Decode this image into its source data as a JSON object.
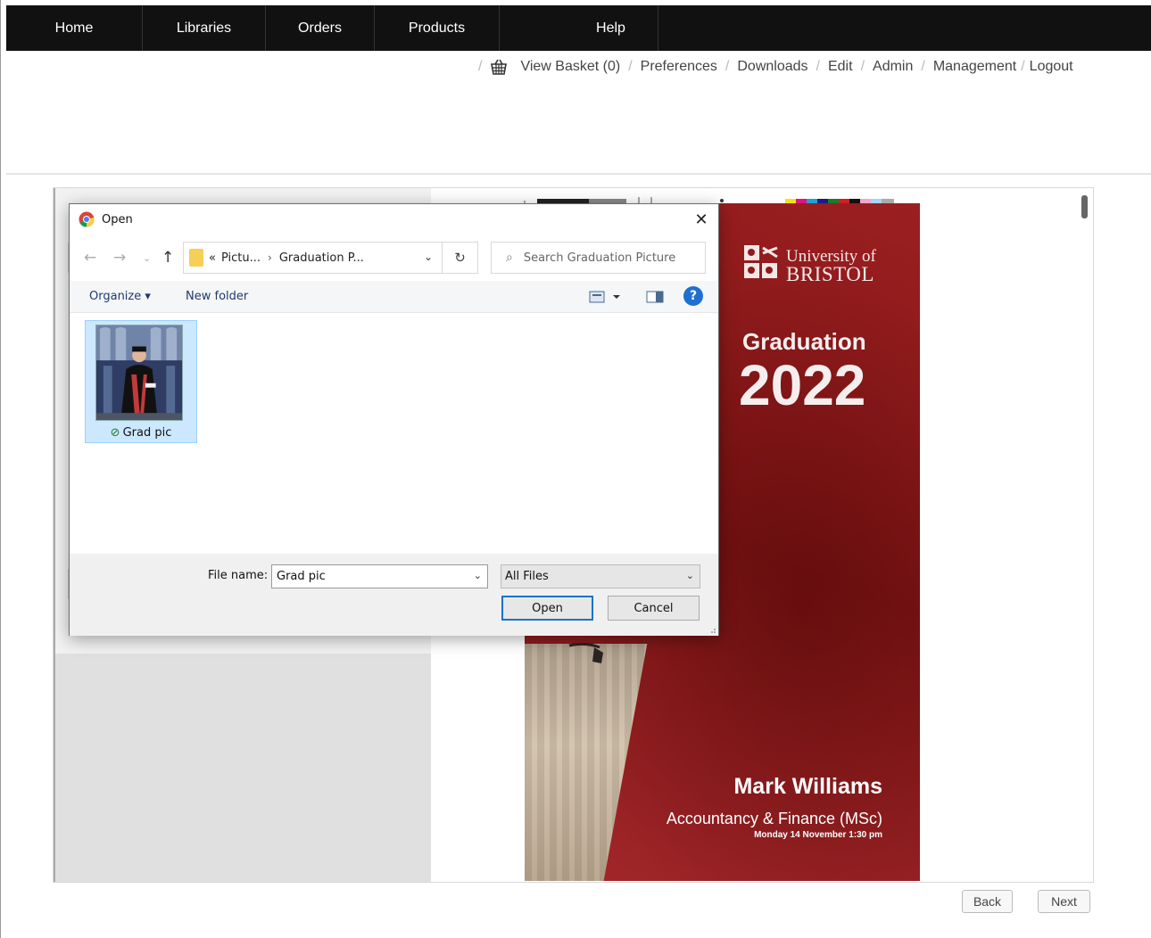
{
  "topnav": {
    "items": [
      "Home",
      "Libraries",
      "Orders",
      "Products",
      "Help"
    ]
  },
  "utilnav": {
    "basket": "View Basket (0)",
    "links": [
      "Preferences",
      "Downloads",
      "Edit",
      "Admin",
      "Management",
      "Logout"
    ]
  },
  "poster": {
    "university_line1": "University of",
    "university_line2": "BRISTOL",
    "heading": "Graduation",
    "year": "2022",
    "name": "Mark Williams",
    "course": "Accountancy & Finance (MSc)",
    "date": "Monday 14 November 1:30 pm",
    "accent_color": "#8f1a1b"
  },
  "editor": {
    "back_label": "Back",
    "next_label": "Next"
  },
  "dialog": {
    "title": "Open",
    "close_icon": "close-icon",
    "breadcrumb": [
      "«",
      "Pictu...",
      "Graduation P..."
    ],
    "search_placeholder": "Search Graduation Picture",
    "toolbar": {
      "organize": "Organize ▾",
      "new_folder": "New folder"
    },
    "files": [
      {
        "name": "Grad pic",
        "status_icon": "sync-ok-icon"
      }
    ],
    "file_name_label": "File name:",
    "file_name_value": "Grad pic",
    "file_type": "All Files",
    "open_label": "Open",
    "cancel_label": "Cancel"
  }
}
